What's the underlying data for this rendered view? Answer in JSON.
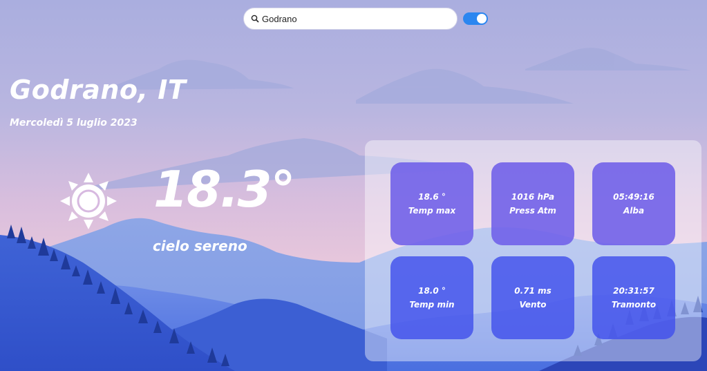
{
  "search": {
    "value": "Godrano",
    "icon": "search-icon"
  },
  "toggle": {
    "state": "on",
    "color": "#2b86f0"
  },
  "location": {
    "city": "Godrano, IT",
    "date": "Mercoledì 5 luglio 2023"
  },
  "current": {
    "icon": "sun-icon",
    "temperature": "18.3°",
    "description": "cielo sereno"
  },
  "tiles": [
    {
      "value": "18.6 °",
      "label": "Temp max"
    },
    {
      "value": "1016 hPa",
      "label": "Press Atm"
    },
    {
      "value": "05:49:16",
      "label": "Alba"
    },
    {
      "value": "18.0 °",
      "label": "Temp min"
    },
    {
      "value": "0.71 ms",
      "label": "Vento"
    },
    {
      "value": "20:31:57",
      "label": "Tramonto"
    }
  ]
}
